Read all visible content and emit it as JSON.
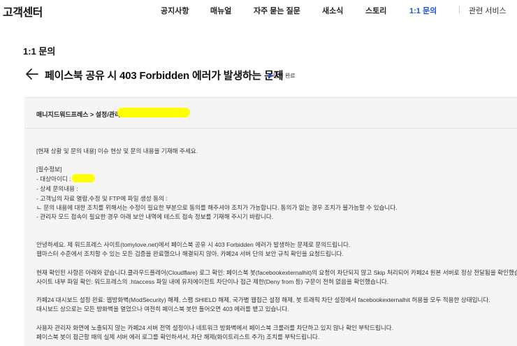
{
  "header": {
    "brand": "고객센터",
    "nav": [
      "공지사항",
      "매뉴얼",
      "자주 묻는 질문",
      "새소식",
      "스토리",
      "1:1 문의"
    ],
    "related": "관련 서비스"
  },
  "section_title": "1:1 문의",
  "post": {
    "title": "페이스북 공유 시 403 Forbidden 에러가 발생하는 문제",
    "status": "답변 완료"
  },
  "breadcrumb": "매니지드워드프레스 > 설정/관리",
  "body_lines": [
    "[현재 상황 및 문의 내용] 이슈 현상 및 문의 내용을 기재해 주세요.",
    "[필수정보]",
    "- 대상아이디 :",
    "- 상세 문의내용 :",
    "- 고객님의 자료 열람,수정 및 FTP에 파일 생성 동의 :",
    "  ㄴ 문의 내용에 대한 조치를 위해서는 수정이 필요한 부분으로 동의를 해주셔야 조치가 가능합니다. 동의가 없는 경우 조치가 불가능할 수 있습니다.",
    "- 관리자 모드 접속이 필요한 경우 아래 보안 내역에 테스트 접속 정보를 기재해 주시기 바랍니다.",
    "안녕하세요. 제 워드프레스 사이트(tomylove.net)에서 페이스북 공유 시 403 Forbidden 에러가 발생하는 문제로 문의드립니다.",
    "웹마스터 수준에서 조치할 수 있는 모든 검증을 완료했으나 해결되지 않아, 카페24 서버 단의 보안 규칙 확인을 요청드립니다.",
    "현재 확인된 사항은 아래와 같습니다.클라우드플레어(Cloudflare) 로그 확인: 페이스북 봇(facebookexternalhit)의 요청이 차단되지 않고 Skip 처리되어 카페24 원본 서버로 정상 전달됨을 확인했습니다.",
    "사이트 내부 파일 확인: 워드프레스의 .htaccess 파일 내에 유저에이전트 차단이나 접근 제한(Deny from 등) 구문이 전혀 없음을 확인했습니다.",
    "카페24 대시보드 설정 완료: 웹방화벽(ModSecurity) 해제, 스팸 SHIELD 해제, 국가별 웹접근 설정 해제, 봇 트래픽 차단 설정에서 facebookexternalhit 허용을 모두 적용한 상태입니다.",
    "대시보드 상으로는 모든 방화벽을 열었으나 여전히 페이스북 봇만 들어오면 403 에러를 뱉고 있습니다.",
    "사용자 관리자 화면에 노출되지 않는 카페24 서버 전역 설정이나 네트워크 방화벽에서 페이스북 크롤러를 차단하고 있지 않나 확인 부탁드립니다.",
    "페이스북 봇이 접근할 때의 실제 서버 에러 로그를 확인하셔서, 차단 해제(화이트리스트 추가) 조치를 부탁드립니다."
  ],
  "colors": {
    "accent": "#1d4fd8",
    "highlight": "#ffff00",
    "card": "#f5f5f5"
  },
  "icons": {
    "back": "arrow-left-icon",
    "status": "dot-icon"
  }
}
